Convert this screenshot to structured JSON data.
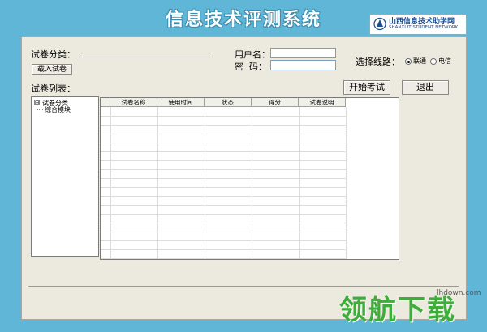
{
  "banner": {
    "title": "信息技术评测系统"
  },
  "logo": {
    "name_cn": "山西信息技术助学网",
    "name_en": "SHANXI IT STUDENT NETWORK"
  },
  "form": {
    "paper_category_label": "试卷分类：",
    "load_paper_button": "载入试卷",
    "username_label": "用户名：",
    "username_value": "",
    "password_label": "密  码：",
    "password_value": "",
    "route_label": "选择线路：",
    "routes": [
      {
        "label": "联通",
        "selected": true
      },
      {
        "label": "电信",
        "selected": false
      }
    ],
    "paper_list_label": "试卷列表：",
    "start_button": "开始考试",
    "exit_button": "退出"
  },
  "tree": {
    "root": "试卷分类",
    "root_expander": "⊟",
    "children": [
      "综合模块"
    ]
  },
  "table": {
    "columns": [
      "试卷名称",
      "使用时间",
      "状态",
      "得分",
      "试卷说明"
    ]
  },
  "watermark": {
    "text": "领航下载",
    "url": "lhdown.com"
  },
  "colors": {
    "background": "#5fb6d6",
    "panel": "#eceadf",
    "watermark": "#3dae3a"
  }
}
